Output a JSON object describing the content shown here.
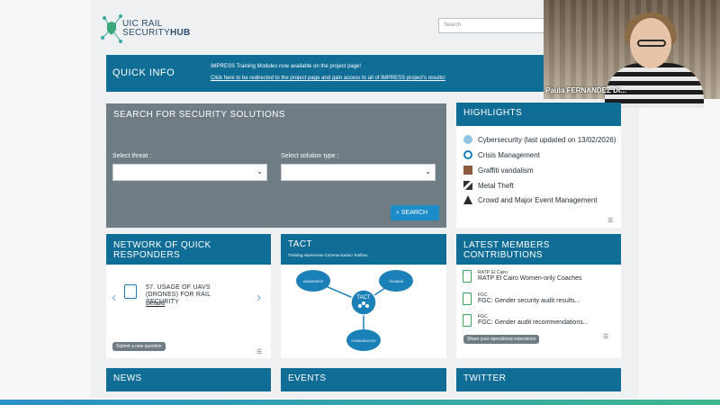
{
  "header": {
    "logo_line1": "UIC RAIL",
    "logo_line2a": "SECURITY",
    "logo_line2b": "HUB",
    "search_placeholder": "Search"
  },
  "quick_info": {
    "title": "QUICK INFO",
    "line1": "IMPRESS Training Modules now available on the project page!",
    "line2": "Click here to be redirected to the project page and gain access to all of IMPRESS project's results!"
  },
  "video": {
    "name": "Paula FERNANDEZ DI..."
  },
  "search_panel": {
    "title": "SEARCH FOR SECURITY SOLUTIONS",
    "threat_label": "Select threat :",
    "solution_label": "Select solution type :",
    "button_label": "SEARCH"
  },
  "highlights": {
    "title": "HIGHLIGHTS",
    "items": [
      {
        "label": "Cybersecurity (last updated on 13/02/2026)",
        "icon": "cyber-icon"
      },
      {
        "label": "Crisis Management",
        "icon": "link-icon"
      },
      {
        "label": "Graffiti vandalism",
        "icon": "graffiti-icon"
      },
      {
        "label": "Metal Theft",
        "icon": "metal-icon"
      },
      {
        "label": "Crowd and Major Event Management",
        "icon": "crowd-icon"
      }
    ]
  },
  "nqr": {
    "title_line1": "NETWORK OF QUICK",
    "title_line2": "RESPONDERS",
    "question": "57. USAGE OF UAVS (DRONES) FOR RAIL SECURITY",
    "details": "Details",
    "submit": "Submit a new question"
  },
  "tact": {
    "title": "TACT",
    "subtitle": "Training Awareness Communication Toolbox",
    "center": "TACT",
    "awareness": "AWARENESS",
    "training": "TRAINING",
    "communication": "COMMUNICATION"
  },
  "lmc": {
    "title_line1": "LATEST MEMBERS",
    "title_line2": "CONTRIBUTIONS",
    "items": [
      {
        "org": "RATP, El Cairo",
        "text": "RATP El Cairo Women-only Coaches"
      },
      {
        "org": "FGC",
        "text": "FGC: Gender security audit results..."
      },
      {
        "org": "FGC",
        "text": "FGC: Gender audit recommendations..."
      }
    ],
    "share": "Share your operational experience"
  },
  "bottom": {
    "news": "NEWS",
    "events": "EVENTS",
    "twitter": "TWITTER"
  },
  "colors": {
    "primary": "#0f6d96",
    "grey_panel": "#6f7c84",
    "button": "#1c8cc8"
  }
}
